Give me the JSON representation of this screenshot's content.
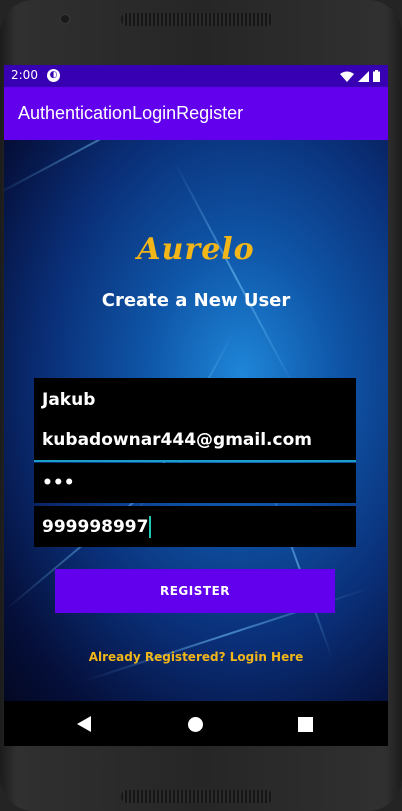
{
  "status_bar": {
    "time": "2:00",
    "notification_icon": "data-saver-icon",
    "icons": [
      "wifi-icon",
      "signal-icon",
      "battery-icon"
    ]
  },
  "app_bar": {
    "title": "AuthenticationLoginRegister"
  },
  "form": {
    "logo": "Aurelo",
    "heading": "Create a New User",
    "full_name_value": "Jakub",
    "email_value": "kubadownar444@gmail.com",
    "password_value": "•••",
    "phone_value": "999998997",
    "register_label": "REGISTER",
    "login_link": "Already Registered? Login Here"
  },
  "colors": {
    "primary": "#6200ee",
    "status_bar": "#3700b3",
    "accent_text": "#f2b619"
  },
  "nav_bar": {
    "icons": [
      "back-icon",
      "home-icon",
      "recents-icon"
    ]
  }
}
